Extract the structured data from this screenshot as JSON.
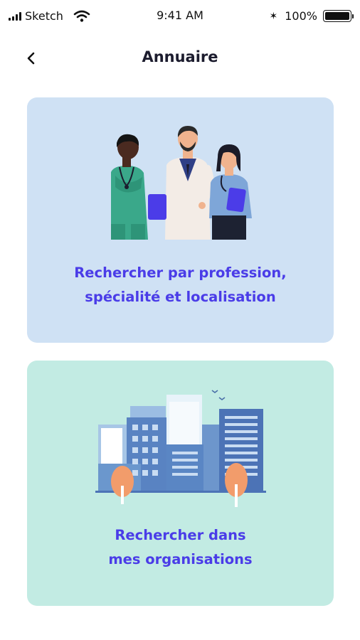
{
  "status_bar": {
    "carrier": "Sketch",
    "time": "9:41 AM",
    "battery": "100%",
    "battery_level": 1.0
  },
  "nav": {
    "title": "Annuaire",
    "back_icon": "chevron-left-icon"
  },
  "cards": [
    {
      "line1": "Rechercher par profession,",
      "line2": "spécialité et localisation",
      "illustration": "healthcare-professionals-illustration"
    },
    {
      "line1": "Rechercher dans",
      "line2": "mes organisations",
      "illustration": "city-buildings-illustration"
    }
  ],
  "colors": {
    "accent": "#4a3ce8",
    "card1_bg": "#cfe1f4",
    "card2_bg": "#c2ebe3"
  }
}
